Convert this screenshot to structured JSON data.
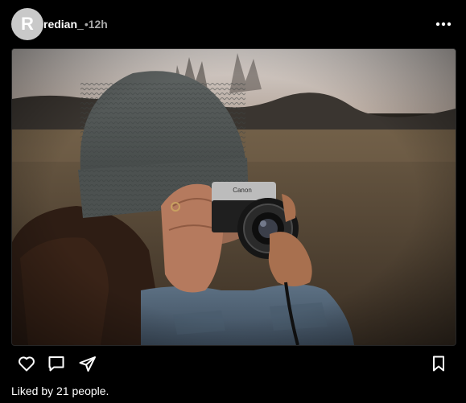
{
  "post": {
    "avatar_initial": "R",
    "username": "redian_",
    "separator": "•",
    "time": "12h",
    "likes_text": "Liked by 21 people."
  },
  "icons": {
    "more": "more-horizontal-icon",
    "like": "heart-icon",
    "comment": "comment-bubble-icon",
    "share": "paper-plane-icon",
    "save": "bookmark-icon"
  },
  "colors": {
    "background": "#000000",
    "text": "#ffffff",
    "muted": "#a8a8a8",
    "avatar": "#c9c9c9"
  }
}
